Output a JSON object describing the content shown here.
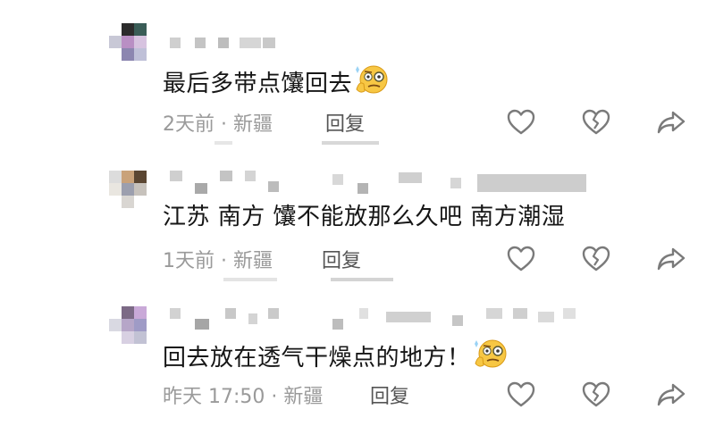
{
  "comments": [
    {
      "text": "最后多带点馕回去",
      "emoji": "monocle-face",
      "time": "2天前",
      "location": "新疆",
      "reply_label": "回复"
    },
    {
      "text": "江苏 南方 馕不能放那么久吧 南方潮湿",
      "time": "1天前",
      "location": "新疆",
      "reply_label": "回复"
    },
    {
      "text": "回去放在透气干燥点的地方！",
      "emoji": "monocle-face",
      "time": "昨天 17:50",
      "location": "新疆",
      "reply_label": "回复"
    }
  ],
  "separator": " · ",
  "icons": {
    "like": "heart-outline-icon",
    "dislike": "broken-heart-outline-icon",
    "share": "share-arrow-icon"
  },
  "colors": {
    "text": "#161616",
    "meta": "#9a9a9a",
    "icon": "#7a7a7a"
  }
}
